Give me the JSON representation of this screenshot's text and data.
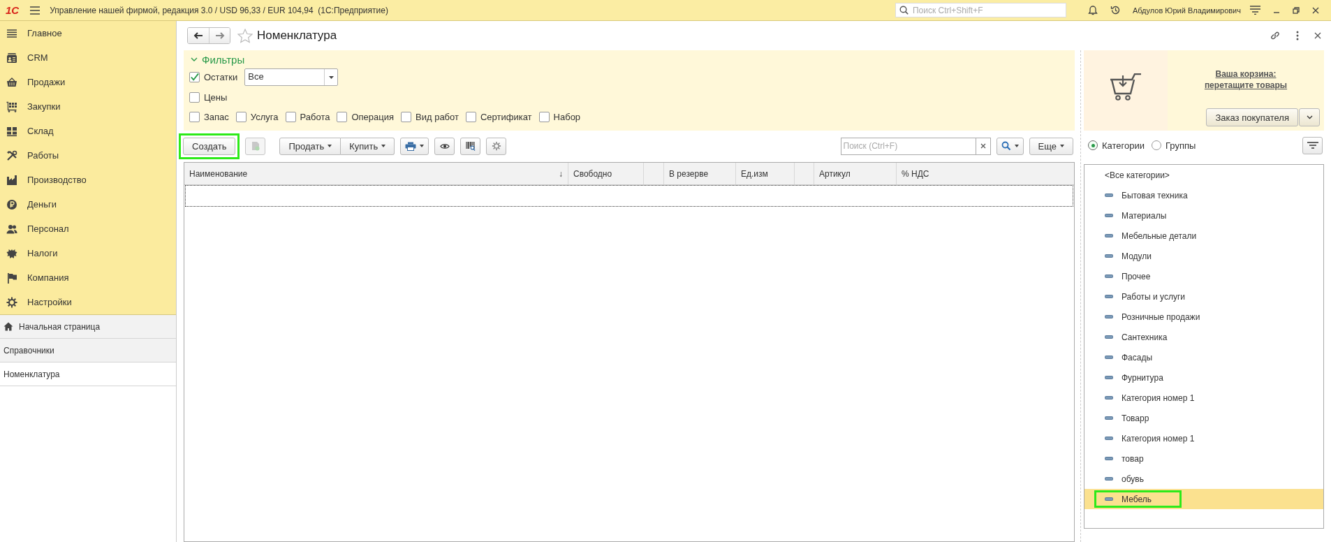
{
  "topbar": {
    "logo": "1С",
    "title": "Управление нашей фирмой, редакция 3.0 / USD 96,33 / EUR 104,94  (1С:Предприятие)",
    "search": {
      "placeholder": "Поиск Ctrl+Shift+F"
    },
    "user": "Абдулов Юрий Владимирович"
  },
  "sidebar": {
    "sections": [
      {
        "label": "Главное"
      },
      {
        "label": "CRM"
      },
      {
        "label": "Продажи"
      },
      {
        "label": "Закупки"
      },
      {
        "label": "Склад"
      },
      {
        "label": "Работы"
      },
      {
        "label": "Производство"
      },
      {
        "label": "Деньги"
      },
      {
        "label": "Персонал"
      },
      {
        "label": "Налоги"
      },
      {
        "label": "Компания"
      },
      {
        "label": "Настройки"
      }
    ],
    "open_pages": [
      {
        "label": "Начальная страница",
        "home": true,
        "selected": false
      },
      {
        "label": "Справочники",
        "home": false,
        "selected": false
      },
      {
        "label": "Номенклатура",
        "home": false,
        "selected": true
      }
    ]
  },
  "form": {
    "title": "Номенклатура",
    "filters": {
      "title": "Фильтры",
      "expanded": true,
      "stock": {
        "label": "Остатки",
        "checked": true,
        "value": "Все"
      },
      "prices": {
        "label": "Цены",
        "checked": false
      },
      "types": [
        {
          "label": "Запас",
          "checked": false
        },
        {
          "label": "Услуга",
          "checked": false
        },
        {
          "label": "Работа",
          "checked": false
        },
        {
          "label": "Операция",
          "checked": false
        },
        {
          "label": "Вид работ",
          "checked": false
        },
        {
          "label": "Сертификат",
          "checked": false
        },
        {
          "label": "Набор",
          "checked": false
        }
      ]
    },
    "toolbar": {
      "create": {
        "label": "Создать",
        "highlighted": true
      },
      "sell": "Продать",
      "buy": "Купить",
      "search": {
        "placeholder": "Поиск (Ctrl+F)"
      },
      "more": "Еще"
    },
    "table": {
      "columns": [
        {
          "label": "Наименование",
          "sort_mark": "↓"
        },
        {
          "label": "Свободно"
        },
        {},
        {
          "label": "В резерве"
        },
        {
          "label": "Ед.изм"
        },
        {},
        {
          "label": "Артикул"
        },
        {
          "label": "% НДС"
        }
      ]
    }
  },
  "basket": {
    "link_line1": "Ваша корзина:",
    "link_line2": "перетащите товары",
    "order_button": "Заказ покупателя"
  },
  "categories": {
    "modes": [
      {
        "label": "Категории",
        "selected": true
      },
      {
        "label": "Группы",
        "selected": false
      }
    ],
    "all": "<Все категории>",
    "items": [
      {
        "label": "Бытовая техника",
        "selected": false,
        "highlighted": false
      },
      {
        "label": "Материалы",
        "selected": false,
        "highlighted": false
      },
      {
        "label": "Мебельные детали",
        "selected": false,
        "highlighted": false
      },
      {
        "label": "Модули",
        "selected": false,
        "highlighted": false
      },
      {
        "label": "Прочее",
        "selected": false,
        "highlighted": false
      },
      {
        "label": "Работы и услуги",
        "selected": false,
        "highlighted": false
      },
      {
        "label": "Розничные продажи",
        "selected": false,
        "highlighted": false
      },
      {
        "label": "Сантехника",
        "selected": false,
        "highlighted": false
      },
      {
        "label": "Фасады",
        "selected": false,
        "highlighted": false
      },
      {
        "label": "Фурнитура",
        "selected": false,
        "highlighted": false
      },
      {
        "label": "Категория номер 1",
        "selected": false,
        "highlighted": false
      },
      {
        "label": "Товарр",
        "selected": false,
        "highlighted": false
      },
      {
        "label": "Категория номер 1",
        "selected": false,
        "highlighted": false
      },
      {
        "label": "товар",
        "selected": false,
        "highlighted": false
      },
      {
        "label": "обувь",
        "selected": false,
        "highlighted": false
      },
      {
        "label": "Мебель",
        "selected": true,
        "highlighted": true
      }
    ]
  }
}
